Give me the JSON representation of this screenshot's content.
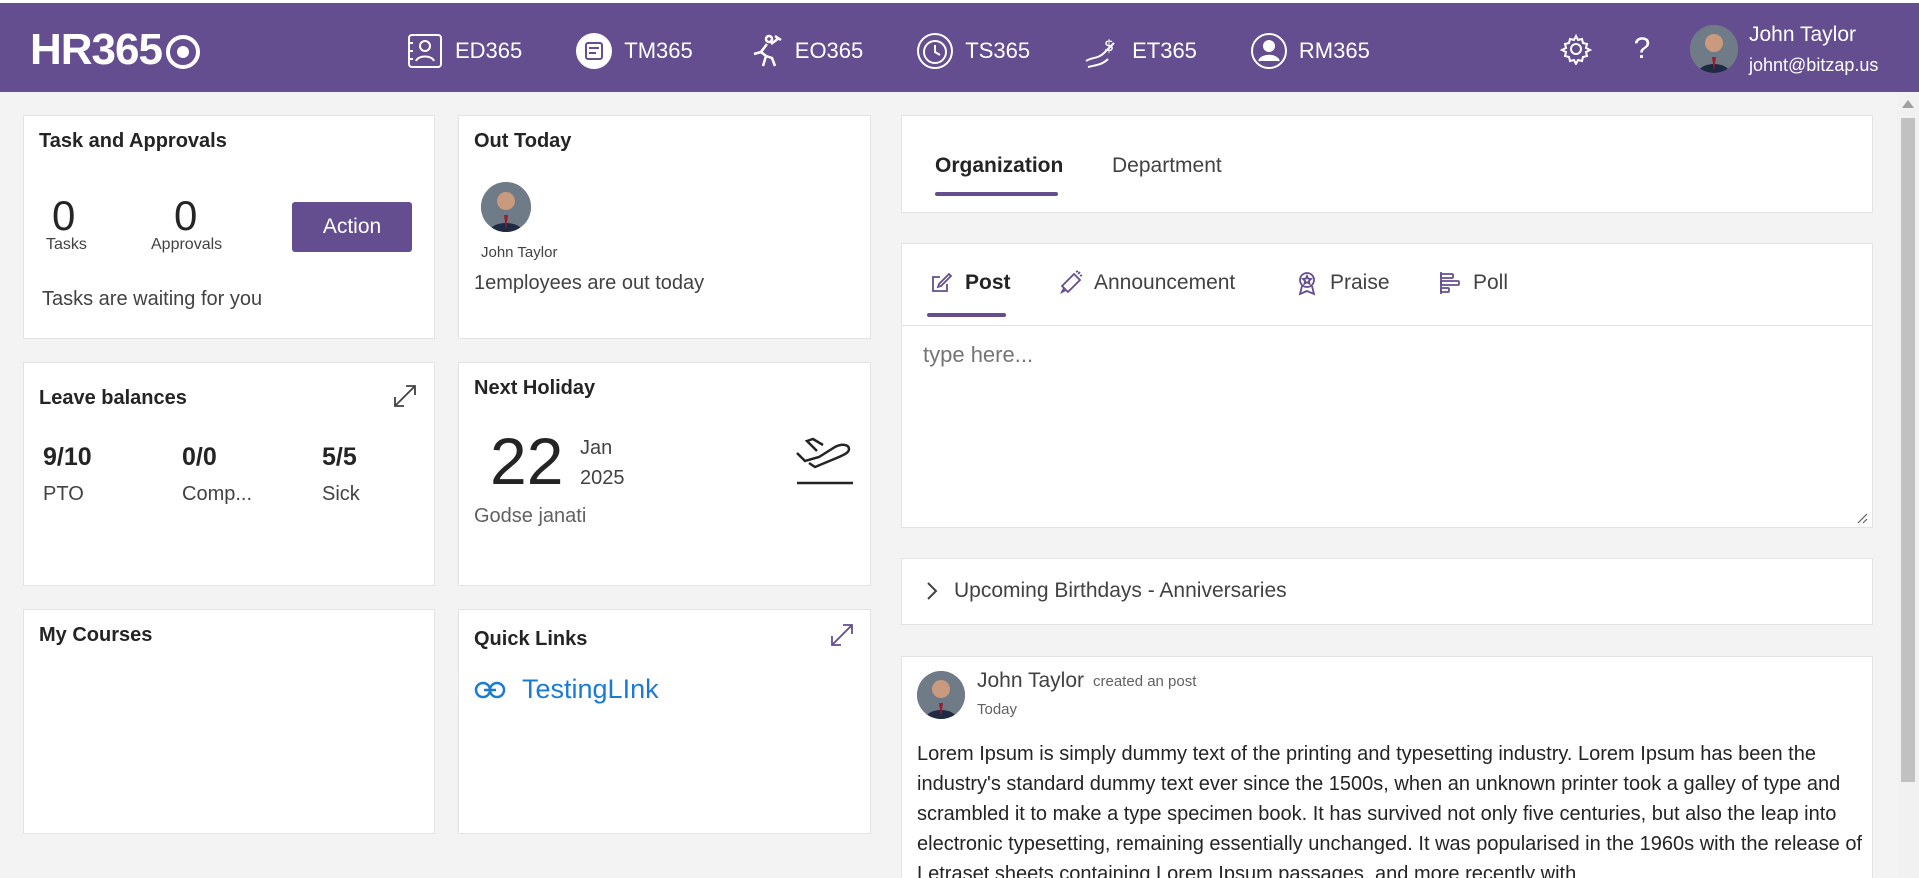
{
  "brand": {
    "logo_text": "HR365"
  },
  "apps": [
    {
      "label": "ED365",
      "icon": "employee-directory-icon"
    },
    {
      "label": "TM365",
      "icon": "task-management-icon"
    },
    {
      "label": "EO365",
      "icon": "employee-onboarding-icon"
    },
    {
      "label": "TS365",
      "icon": "timesheet-icon"
    },
    {
      "label": "ET365",
      "icon": "expense-tracker-icon"
    },
    {
      "label": "RM365",
      "icon": "recruitment-icon"
    }
  ],
  "user": {
    "name": "John Taylor",
    "email": "johnt@bitzap.us"
  },
  "tasks_card": {
    "title": "Task and Approvals",
    "tasks_count": "0",
    "tasks_label": "Tasks",
    "approvals_count": "0",
    "approvals_label": "Approvals",
    "action_label": "Action",
    "message": "Tasks are waiting for you"
  },
  "out_today": {
    "title": "Out Today",
    "person_name": "John Taylor",
    "summary": "1employees are out today"
  },
  "leave_balances": {
    "title": "Leave balances",
    "items": [
      {
        "value": "9/10",
        "label": "PTO"
      },
      {
        "value": "0/0",
        "label": "Comp..."
      },
      {
        "value": "5/5",
        "label": "Sick"
      }
    ]
  },
  "next_holiday": {
    "title": "Next Holiday",
    "day": "22",
    "month": "Jan",
    "year": "2025",
    "name": "Godse janati"
  },
  "my_courses": {
    "title": "My Courses"
  },
  "quick_links": {
    "title": "Quick Links",
    "links": [
      {
        "label": "TestingLInk"
      }
    ]
  },
  "scope_tabs": [
    {
      "label": "Organization",
      "active": true
    },
    {
      "label": "Department",
      "active": false
    }
  ],
  "post_tabs": [
    {
      "label": "Post",
      "icon": "edit-icon",
      "active": true
    },
    {
      "label": "Announcement",
      "icon": "megaphone-icon",
      "active": false
    },
    {
      "label": "Praise",
      "icon": "badge-icon",
      "active": false
    },
    {
      "label": "Poll",
      "icon": "poll-icon",
      "active": false
    }
  ],
  "post_input": {
    "placeholder": "type here..."
  },
  "birthdays": {
    "label": "Upcoming Birthdays - Anniversaries"
  },
  "feed_post": {
    "author": "John Taylor",
    "action": "created an post",
    "time": "Today",
    "body": "Lorem Ipsum is simply dummy text of the printing and typesetting industry. Lorem Ipsum has been the industry's standard dummy text ever since the 1500s, when an unknown printer took a galley of type and scrambled it to make a type specimen book. It has survived not only five centuries, but also the leap into electronic typesetting, remaining essentially unchanged. It was popularised in the 1960s with the release of Letraset sheets containing Lorem Ipsum passages, and more recently with"
  },
  "colors": {
    "brand": "#644e8f",
    "link": "#1a7bd4"
  }
}
